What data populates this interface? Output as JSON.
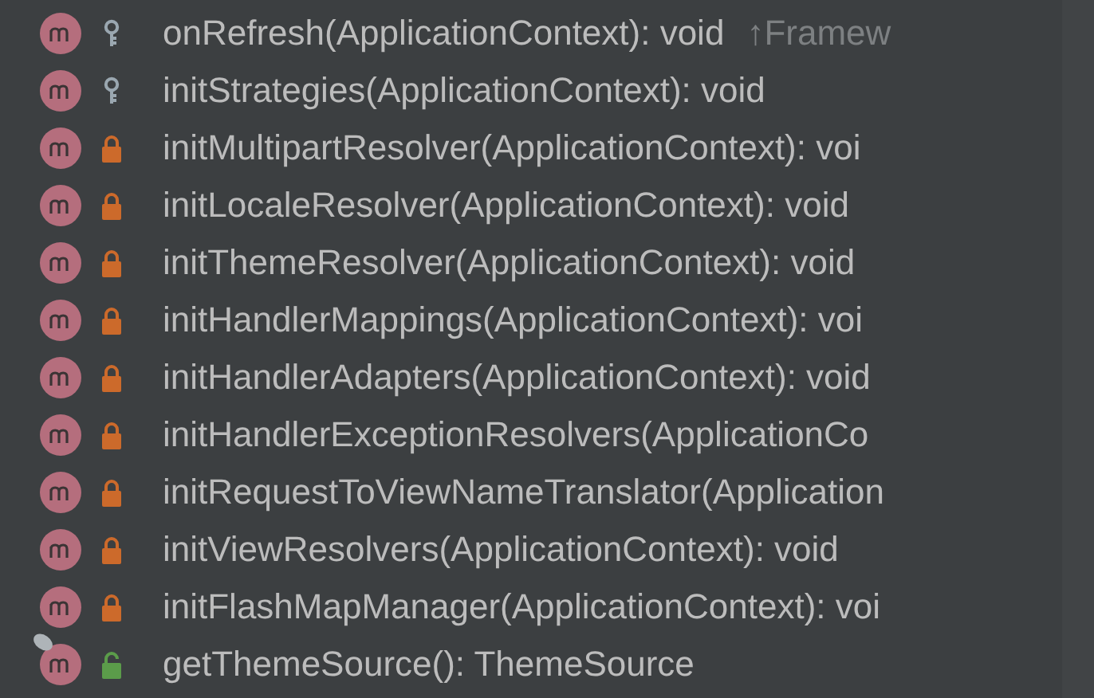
{
  "members": [
    {
      "name": "onRefresh(ApplicationContext): void",
      "inherited": "↑Framew",
      "kind": "protected",
      "overlay": false
    },
    {
      "name": "initStrategies(ApplicationContext): void",
      "kind": "protected",
      "overlay": false
    },
    {
      "name": "initMultipartResolver(ApplicationContext): voi",
      "kind": "private",
      "overlay": false
    },
    {
      "name": "initLocaleResolver(ApplicationContext): void",
      "kind": "private",
      "overlay": false
    },
    {
      "name": "initThemeResolver(ApplicationContext): void",
      "kind": "private",
      "overlay": false
    },
    {
      "name": "initHandlerMappings(ApplicationContext): voi",
      "kind": "private",
      "overlay": false
    },
    {
      "name": "initHandlerAdapters(ApplicationContext): void",
      "kind": "private",
      "overlay": false
    },
    {
      "name": "initHandlerExceptionResolvers(ApplicationCo",
      "kind": "private",
      "overlay": false
    },
    {
      "name": "initRequestToViewNameTranslator(Application",
      "kind": "private",
      "overlay": false
    },
    {
      "name": "initViewResolvers(ApplicationContext): void",
      "kind": "private",
      "overlay": false
    },
    {
      "name": "initFlashMapManager(ApplicationContext): voi",
      "kind": "private",
      "overlay": false
    },
    {
      "name": "getThemeSource(): ThemeSource",
      "kind": "public",
      "overlay": true
    }
  ]
}
